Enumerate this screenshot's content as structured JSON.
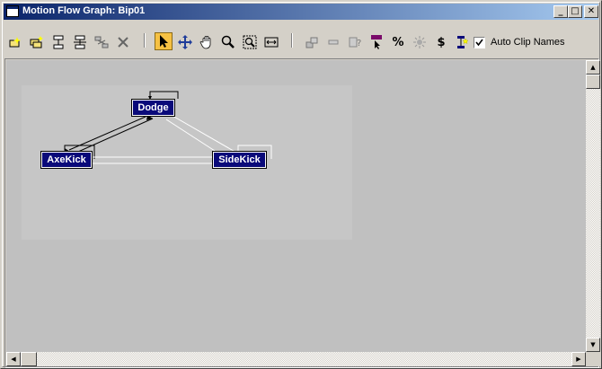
{
  "window": {
    "title": "Motion Flow Graph: Bip01",
    "controls": {
      "minimize": "_",
      "maximize": "□",
      "close": "✕"
    }
  },
  "toolbar": {
    "tools": [
      {
        "name": "create-clip-icon"
      },
      {
        "name": "create-multiple-clips-icon"
      },
      {
        "name": "create-transition-icon"
      },
      {
        "name": "create-transitions-from-to-icon"
      },
      {
        "name": "optimize-transitions-icon"
      },
      {
        "name": "delete-icon"
      },
      {
        "name": "select-arrow-icon",
        "active": true
      },
      {
        "name": "move-icon"
      },
      {
        "name": "pan-hand-icon"
      },
      {
        "name": "zoom-icon"
      },
      {
        "name": "zoom-region-icon"
      },
      {
        "name": "zoom-extents-icon"
      },
      {
        "name": "show-scripts-icon"
      },
      {
        "name": "random-path-icon"
      },
      {
        "name": "show-random-icon"
      },
      {
        "name": "select-random-icon"
      },
      {
        "name": "percent-random-icon"
      },
      {
        "name": "animated-icon"
      },
      {
        "name": "cost-icon"
      },
      {
        "name": "clip-names-icon"
      }
    ],
    "percent_glyph": "%",
    "dollar_glyph": "$",
    "auto_clip_names": {
      "label": "Auto Clip Names",
      "checked": true
    }
  },
  "graph": {
    "nodes": [
      {
        "id": "dodge",
        "label": "Dodge"
      },
      {
        "id": "axekick",
        "label": "AxeKick"
      },
      {
        "id": "sidekick",
        "label": "SideKick"
      }
    ],
    "colors": {
      "node_fill": "#0a0a7a",
      "node_text": "#ffffff",
      "canvas": "#c0c0c0",
      "graph_area": "#c6c6c6"
    }
  }
}
